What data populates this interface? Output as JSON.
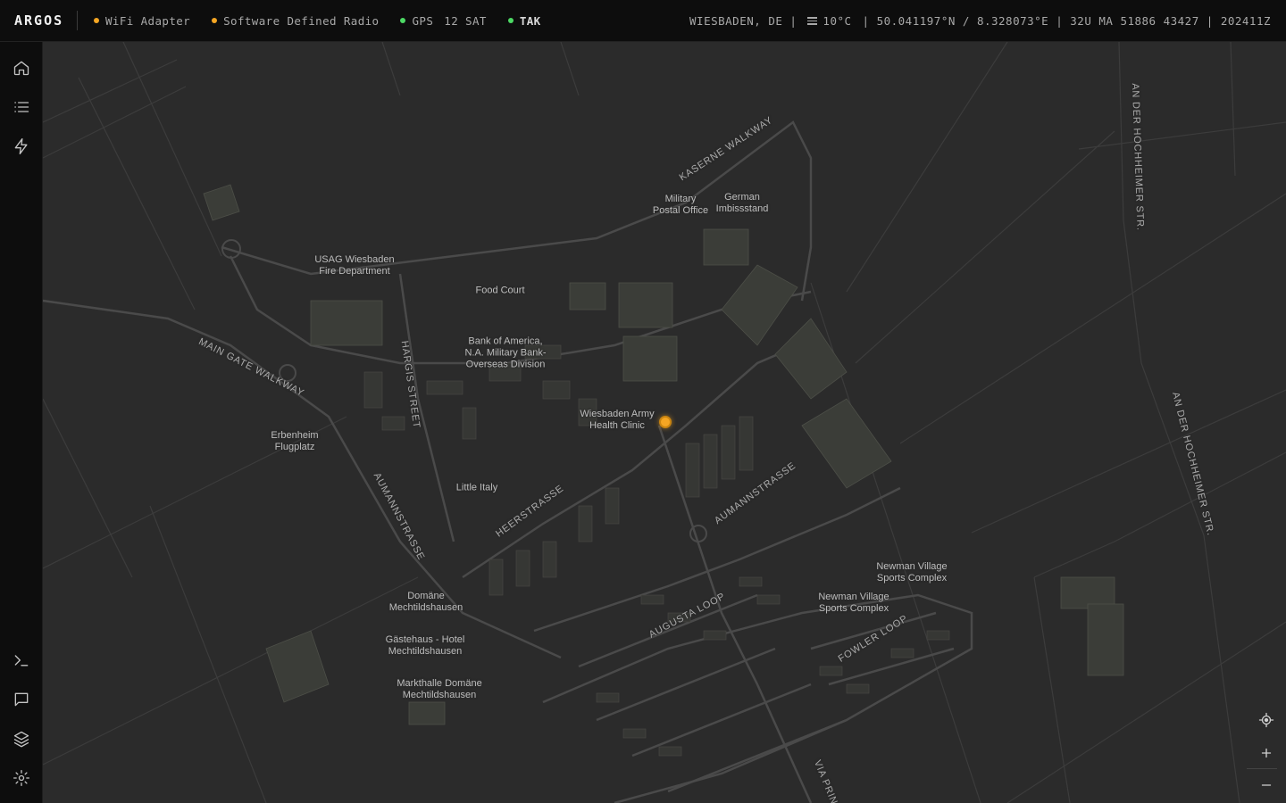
{
  "app": {
    "title": "ARGOS"
  },
  "status_items": [
    {
      "label": "WiFi Adapter",
      "dot_color": "#f5a623"
    },
    {
      "label": "Software Defined Radio",
      "dot_color": "#f5a623"
    },
    {
      "label": "GPS",
      "extra": "12 SAT",
      "dot_color": "#4cd964"
    },
    {
      "label": "TAK",
      "dot_color": "#4cd964"
    }
  ],
  "info": {
    "location": "WIESBADEN, DE |",
    "weather_icon": "fog-icon",
    "temperature": "10°C",
    "coords": "| 50.041197°N / 8.328073°E | 32U MA 51886 43427 | 202411Z"
  },
  "sidebar": {
    "top": [
      "home-icon",
      "list-icon",
      "bolt-icon"
    ],
    "bottom": [
      "terminal-icon",
      "chat-icon",
      "layers-icon",
      "settings-icon"
    ]
  },
  "map": {
    "places": [
      {
        "name": "USAG Wiesbaden\nFire Department"
      },
      {
        "name": "Food Court"
      },
      {
        "name": "Bank of America,\nN.A. Military Bank-\nOverseas Division"
      },
      {
        "name": "Military\nPostal Office"
      },
      {
        "name": "German\nImbissstand"
      },
      {
        "name": "Wiesbaden Army\nHealth Clinic"
      },
      {
        "name": "Erbenheim\nFlugplatz"
      },
      {
        "name": "Little Italy"
      },
      {
        "name": "Domäne\nMechtildshausen"
      },
      {
        "name": "Gästehaus - Hotel\nMechtildshausen"
      },
      {
        "name": "Markthalle Domäne\nMechtildshausen"
      },
      {
        "name": "Newman Village\nSports Complex"
      },
      {
        "name": "Newman Village\nSports Complex"
      }
    ],
    "streets": [
      "KASERNE WALKWAY",
      "MAIN GATE WALKWAY",
      "HARGIS STREET",
      "AUMANNSTRASSE",
      "HEERSTRASSE",
      "AUMANNSTRASSE",
      "AUGUSTA LOOP",
      "FOWLER LOOP",
      "VIA PRIN",
      "AN DER HOCHHEIMER STR.",
      "AN DER HOCHHEIMER STR."
    ],
    "marker_color": "#f5a623"
  },
  "controls": [
    "locate-icon",
    "zoom-in-icon",
    "zoom-out-icon"
  ]
}
